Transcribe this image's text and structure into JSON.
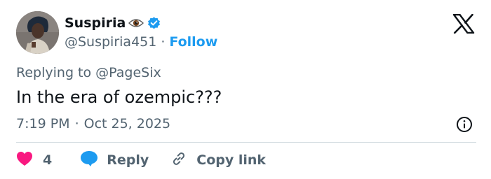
{
  "user": {
    "display_name": "Suspiria",
    "eye_emoji_icon": "eye-icon",
    "verified_icon": "verified-badge-icon",
    "handle": "@Suspiria451",
    "separator": "·",
    "follow_label": "Follow",
    "avatar": "avatar"
  },
  "brand_icon": "x-logo-icon",
  "tweet": {
    "replying_prefix": "Replying to ",
    "replying_to": "@PageSix",
    "text": "In the era of ozempic???",
    "time": "7:19 PM",
    "separator": "·",
    "date": "Oct 25, 2025",
    "info_icon": "info-icon"
  },
  "actions": {
    "like_icon": "heart-icon",
    "like_count": "4",
    "reply_icon": "speech-bubble-icon",
    "reply_label": "Reply",
    "copy_icon": "link-icon",
    "copy_label": "Copy link"
  },
  "colors": {
    "accent": "#1d9bf0",
    "like": "#f91880",
    "text_primary": "#0f1419",
    "text_secondary": "#536471",
    "divider": "#cfd9de"
  }
}
